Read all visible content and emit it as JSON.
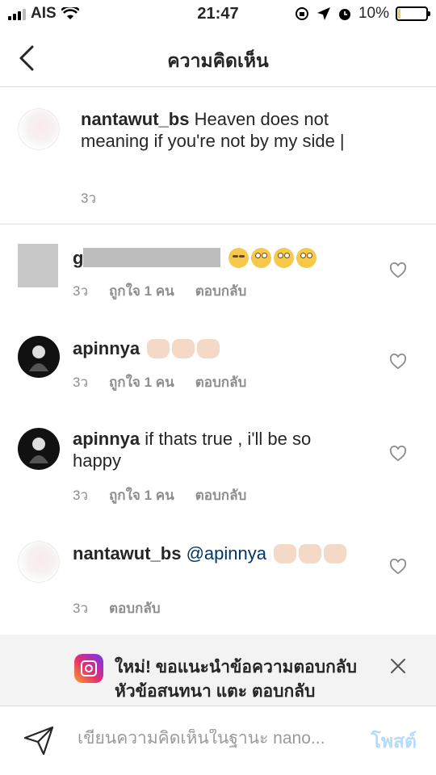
{
  "status_bar": {
    "carrier": "AIS",
    "time": "21:47",
    "battery": "10%",
    "battery_level": 0.1
  },
  "nav": {
    "title": "ความคิดเห็น",
    "back_icon": "chevron-left-icon"
  },
  "caption": {
    "username": "nantawut_bs",
    "text": "Heaven does not meaning if you're not by my side |",
    "time": "3ว"
  },
  "comments": [
    {
      "username": "g",
      "text": "",
      "emojis": [
        "unamused-face",
        "rolling-eyes-face",
        "rolling-eyes-face",
        "rolling-eyes-face"
      ],
      "time": "3ว",
      "likes": "ถูกใจ 1 คน",
      "reply": "ตอบกลับ"
    },
    {
      "username": "apinnya",
      "text": "",
      "emojis": [
        "oncoming-fist",
        "oncoming-fist",
        "oncoming-fist"
      ],
      "time": "3ว",
      "likes": "ถูกใจ 1 คน",
      "reply": "ตอบกลับ"
    },
    {
      "username": "apinnya",
      "text": "if thats true , i'll be so happy",
      "time": "3ว",
      "likes": "ถูกใจ 1 คน",
      "reply": "ตอบกลับ"
    },
    {
      "username": "nantawut_bs",
      "mention": "@apinnya",
      "emojis": [
        "oncoming-fist",
        "oncoming-fist",
        "oncoming-fist"
      ],
      "time": "3ว",
      "reply": "ตอบกลับ"
    }
  ],
  "banner": {
    "text": "ใหม่! ขอแนะนำข้อความตอบกลับหัวข้อสนทนา แตะ ตอบกลับ",
    "icon": "instagram-icon"
  },
  "composer": {
    "placeholder": "เขียนความคิดเห็นในฐานะ nano...",
    "post_label": "โพสต์"
  },
  "colors": {
    "link": "#003569",
    "post_disabled": "#b3dbff",
    "meta_gray": "#8e8e8e"
  }
}
